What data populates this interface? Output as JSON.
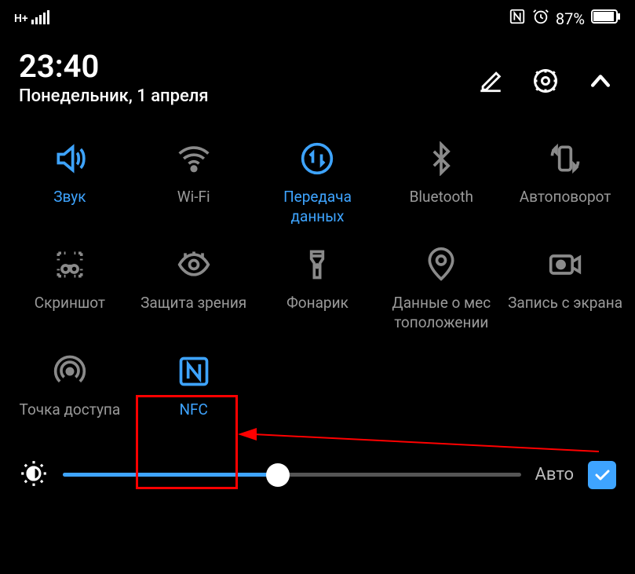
{
  "statusbar": {
    "network": "H+",
    "battery_pct": "87%"
  },
  "header": {
    "time": "23:40",
    "date": "Понедельник, 1 апреля"
  },
  "tiles": [
    {
      "label": "Звук",
      "active": true
    },
    {
      "label": "Wi-Fi",
      "active": false
    },
    {
      "label": "Передача данных",
      "active": true
    },
    {
      "label": "Bluetooth",
      "active": false
    },
    {
      "label": "Автоповорот",
      "active": false
    },
    {
      "label": "Скриншот",
      "active": false
    },
    {
      "label": "Защита зрения",
      "active": false
    },
    {
      "label": "Фонарик",
      "active": false
    },
    {
      "label": "Данные о мес тоположении",
      "active": false
    },
    {
      "label": "Запись с экрана",
      "active": false
    },
    {
      "label": "Точка доступа",
      "active": false
    },
    {
      "label": "NFC",
      "active": true
    }
  ],
  "brightness": {
    "value_pct": 47,
    "auto_label": "Авто",
    "auto_checked": true
  },
  "annotation": {
    "highlight_tile_index": 11,
    "highlight_color": "#ff0000"
  }
}
